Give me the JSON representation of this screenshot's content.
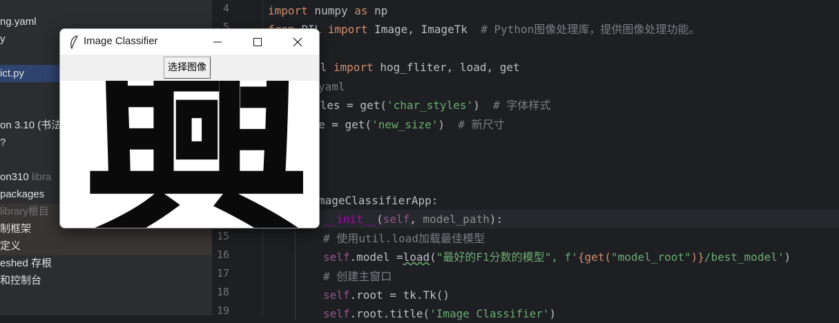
{
  "sidebar": {
    "items": [
      {
        "text": "ng.yaml",
        "dim": ""
      },
      {
        "text": "y",
        "dim": ""
      },
      {
        "text": "ict.py",
        "dim": ""
      },
      {
        "text": "on 3.10 (书法",
        "dim": ""
      },
      {
        "text": "?",
        "dim": ""
      },
      {
        "text": "on310",
        "dim": "libra"
      },
      {
        "text": "packages",
        "dim": ""
      },
      {
        "text": "",
        "dim": "library根目"
      },
      {
        "text": "制框架",
        "dim": ""
      },
      {
        "text": "定义",
        "dim": ""
      },
      {
        "text": "eshed 存根",
        "dim": ""
      },
      {
        "text": "和控制台",
        "dim": ""
      }
    ]
  },
  "editor": {
    "line_numbers": [
      "4",
      "5",
      "15",
      "16",
      "17",
      "18",
      "19"
    ],
    "lines": {
      "l4": {
        "kw1": "import",
        "t1": " numpy ",
        "kw2": "as",
        "t2": " np"
      },
      "l5": {
        "kw1": "from",
        "t1": " PIL ",
        "kw2": "import",
        "t2": " Image, ImageTk  ",
        "cm": "# Python图像处理库，提供图像处理功能。"
      },
      "l6": {
        "t1": "il ",
        "kw1": "import",
        "t2": " hog_fliter, load, get"
      },
      "l7": {
        "cm": "yaml"
      },
      "l8": {
        "t1": "yles = get(",
        "str": "'char_styles'",
        "t2": ")  ",
        "cm": "# 字体样式"
      },
      "l9": {
        "t1": "e = get(",
        "str": "'new_size'",
        "t2": ")  ",
        "cm": "# 新尺寸"
      },
      "l13": {
        "t1": "mageClassifierApp:"
      },
      "l14": {
        "dunder": "__init__",
        "t1": "(",
        "self": "self",
        "t2": ", ",
        "param": "model_path",
        "t3": "):"
      },
      "l15": {
        "cm": "# 使用util.load加载最佳模型"
      },
      "l16": {
        "self": "self",
        "t1": ".model =",
        "ul": "load",
        "t2": "(",
        "str1": "\"最好的F1分数的模型\"",
        "t3": ", f'",
        "t4": "{get(",
        "str2": "\"model_root\"",
        "t5": ")}",
        "str3": "/best_model'",
        "t6": ")"
      },
      "l17": {
        "cm": "# 创建主窗口"
      },
      "l18": {
        "self": "self",
        "t1": ".root = tk.Tk()"
      },
      "l19": {
        "self": "self",
        "t1": ".root.title(",
        "str": "'Image Classifier'",
        "t2": ")"
      }
    }
  },
  "tk_window": {
    "title": "Image Classifier",
    "icon": "feather-icon",
    "minimize_icon": "minimize-icon",
    "maximize_icon": "maximize-icon",
    "close_icon": "close-icon",
    "select_button_label": "选择图像",
    "displayed_character": "興"
  },
  "colors": {
    "keyword": "#cf8e6d",
    "string": "#6aab73",
    "comment": "#7a7e85",
    "self": "#94558d",
    "selection": "#2e436e"
  }
}
